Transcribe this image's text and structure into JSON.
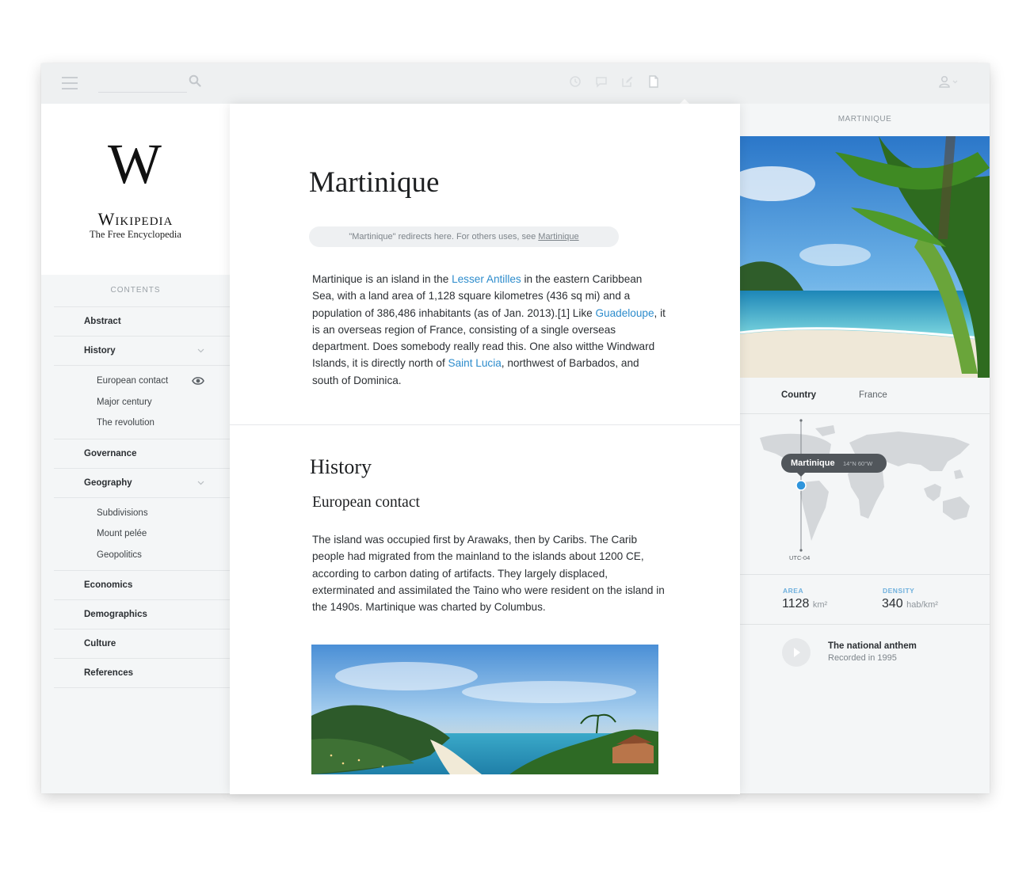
{
  "topbar": {
    "search_placeholder": "",
    "icons": [
      "menu-icon",
      "search-icon",
      "history-icon",
      "talk-icon",
      "edit-icon",
      "article-icon",
      "user-icon"
    ]
  },
  "logo": {
    "title": "Wikipedia",
    "subtitle": "The Free Encyclopedia"
  },
  "toc": {
    "heading": "CONTENTS",
    "items": [
      {
        "label": "Abstract"
      },
      {
        "label": "History",
        "children": [
          "European contact",
          "Major century",
          "The revolution"
        ]
      },
      {
        "label": "Governance"
      },
      {
        "label": "Geography",
        "children": [
          "Subdivisions",
          "Mount pelée",
          "Geopolitics"
        ]
      },
      {
        "label": "Economics"
      },
      {
        "label": "Demographics"
      },
      {
        "label": "Culture"
      },
      {
        "label": "References"
      }
    ]
  },
  "article": {
    "title": "Martinique",
    "redirect_text": "\"Martinique\" redirects here. For others uses, see ",
    "redirect_link": "Martinique",
    "intro": {
      "t1": "Martinique is an island in the ",
      "l1": "Lesser Antilles",
      "t2": " in the eastern Caribbean Sea, with a land area of 1,128 square kilometres (436 sq mi) and a population of 386,486 inhabitants (as of Jan. 2013).[1] Like ",
      "l2": "Guadeloupe",
      "t3": ", it is an overseas region of France, consisting of a single overseas department. Does somebody really read this. One also witthe Windward Islands, it is directly north of ",
      "l3": "Saint Lucia",
      "t4": ", northwest of Barbados, and south of Dominica."
    },
    "history_heading": "History",
    "european_heading": "European contact",
    "history_text": "The island was occupied first by Arawaks, then by Caribs. The Carib people had migrated from the mainland to the islands about 1200 CE, according to carbon dating of artifacts. They largely displaced, exterminated and assimilated the Taino who were resident on the island in the 1490s. Martinique was charted by Columbus."
  },
  "infobox": {
    "header": "MARTINIQUE",
    "country_label": "Country",
    "country_value": "France",
    "map_label": "Martinique",
    "map_coords": "14°N 60°W",
    "utc": "UTC-04",
    "area_label": "AREA",
    "area_value": "1128",
    "area_unit": "km²",
    "density_label": "DENSITY",
    "density_value": "340",
    "density_unit": "hab/km²",
    "anthem_title": "The national anthem",
    "anthem_sub": "Recorded in 1995"
  },
  "colors": {
    "link": "#2d8ccc",
    "accent_blue": "#2f95dc",
    "tooltip_bg": "#51565b"
  }
}
